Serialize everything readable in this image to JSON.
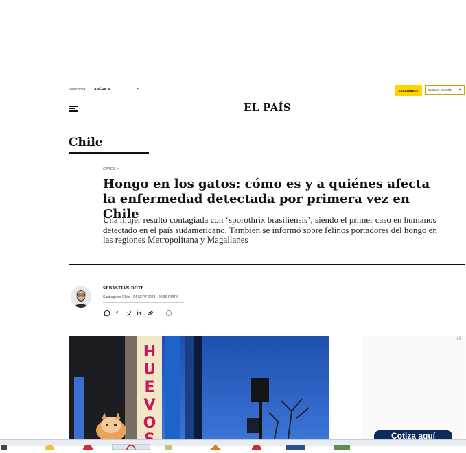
{
  "topbar": {
    "edition_label": "Selecciona:",
    "edition_value": "AMÉRICA",
    "subscribe_label": "SUSCRÍBETE",
    "login_label": "INICIAR SESIÓN"
  },
  "header": {
    "logo": "EL PAÍS"
  },
  "section": {
    "title": "Chile"
  },
  "article": {
    "kicker": "GATOS >",
    "headline": "Hongo en los gatos: cómo es y a quiénes afecta la enfermedad detectada por primera vez en Chile",
    "dek": "Una mujer resultó contagiada con ‘sporothrix brasiliensis’, siendo el primer caso en humanos detectado en el país sudamericano. También se informó sobre felinos portadores del hongo en las regiones Metropolitana y Magallanes",
    "author": "SEBASTIÁN DOTE",
    "dateline": "Santiago de Chile - 04 SEPT 2023 - 00:36 GMT-6"
  },
  "photo": {
    "sign_text": "HUEVOS"
  },
  "ad": {
    "badge": "i X",
    "cta": "Cotiza aquí"
  },
  "colors": {
    "accent": "#ffd400",
    "ad_cta": "#0d2a5c",
    "sky": "#2f62c4"
  }
}
